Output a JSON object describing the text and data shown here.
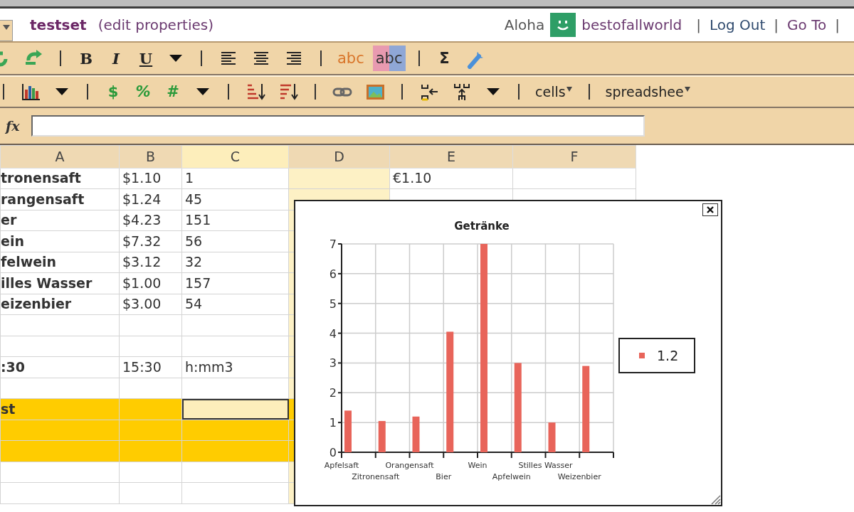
{
  "header": {
    "title": "testset",
    "edit_link": "(edit properties)",
    "greeting": "Aloha",
    "user": "bestofallworld",
    "links": [
      {
        "kind": "separator",
        "text": "|"
      },
      {
        "kind": "link",
        "text": "Log Out"
      },
      {
        "kind": "separator",
        "text": "|"
      },
      {
        "kind": "link",
        "text": "Go To"
      },
      {
        "kind": "separator",
        "text": "|"
      }
    ]
  },
  "toolbar_1": [
    {
      "kind": "undo"
    },
    {
      "kind": "redo"
    },
    {
      "kind": "sep"
    },
    {
      "kind": "bold",
      "text": "B"
    },
    {
      "kind": "italic",
      "text": "I"
    },
    {
      "kind": "underline",
      "text": "U"
    },
    {
      "kind": "caret"
    },
    {
      "kind": "sep"
    },
    {
      "kind": "align-left"
    },
    {
      "kind": "align-center"
    },
    {
      "kind": "align-right"
    },
    {
      "kind": "sep"
    },
    {
      "kind": "text-color",
      "text": "abc"
    },
    {
      "kind": "highlight",
      "text": "abc"
    },
    {
      "kind": "sep"
    },
    {
      "kind": "sum",
      "text": "Σ"
    },
    {
      "kind": "wrench"
    }
  ],
  "toolbar_2": [
    {
      "kind": "sep"
    },
    {
      "kind": "chart"
    },
    {
      "kind": "caret"
    },
    {
      "kind": "sep"
    },
    {
      "kind": "currency",
      "text": "$"
    },
    {
      "kind": "percent",
      "text": "%"
    },
    {
      "kind": "number",
      "text": "#"
    },
    {
      "kind": "caret"
    },
    {
      "kind": "sep"
    },
    {
      "kind": "sort-asc"
    },
    {
      "kind": "sort-desc"
    },
    {
      "kind": "sep"
    },
    {
      "kind": "link"
    },
    {
      "kind": "image"
    },
    {
      "kind": "sep"
    },
    {
      "kind": "merge"
    },
    {
      "kind": "split"
    },
    {
      "kind": "caret"
    },
    {
      "kind": "sep"
    },
    {
      "kind": "menu",
      "text": "cells"
    },
    {
      "kind": "sep"
    },
    {
      "kind": "menu",
      "text": "spreadshee"
    }
  ],
  "formula_bar": {
    "label": "fx"
  },
  "grid": {
    "columns": [
      {
        "label": "A",
        "selected": false,
        "tinted": false
      },
      {
        "label": "B",
        "selected": false,
        "tinted": false
      },
      {
        "label": "C",
        "selected": true,
        "tinted": false
      },
      {
        "label": "D",
        "selected": false,
        "tinted": true
      },
      {
        "label": "E",
        "selected": false,
        "tinted": false
      },
      {
        "label": "F",
        "selected": false,
        "tinted": false
      }
    ],
    "rows": [
      {
        "highlighted": false,
        "selected": false,
        "cells": {
          "A": "tronensaft",
          "B": "$1.10",
          "C": "1",
          "E": "€1.10"
        }
      },
      {
        "highlighted": false,
        "selected": false,
        "cells": {
          "A": "rangensaft",
          "B": "$1.24",
          "C": "45"
        }
      },
      {
        "highlighted": false,
        "selected": false,
        "cells": {
          "A": "er",
          "B": "$4.23",
          "C": "151"
        }
      },
      {
        "highlighted": false,
        "selected": false,
        "cells": {
          "A": "ein",
          "B": "$7.32",
          "C": "56"
        }
      },
      {
        "highlighted": false,
        "selected": false,
        "cells": {
          "A": "felwein",
          "B": "$3.12",
          "C": "32"
        }
      },
      {
        "highlighted": false,
        "selected": false,
        "cells": {
          "A": "illes Wasser",
          "B": "$1.00",
          "C": "157"
        }
      },
      {
        "highlighted": false,
        "selected": false,
        "cells": {
          "A": "eizenbier",
          "B": "$3.00",
          "C": "54"
        }
      },
      {
        "highlighted": false,
        "selected": false,
        "cells": {}
      },
      {
        "highlighted": false,
        "selected": false,
        "cells": {}
      },
      {
        "highlighted": false,
        "selected": false,
        "cells": {
          "A": ":30",
          "B": "15:30",
          "C": "h:mm3"
        }
      },
      {
        "highlighted": false,
        "selected": false,
        "cells": {}
      },
      {
        "highlighted": true,
        "selected": true,
        "cells": {
          "A": "st"
        }
      },
      {
        "highlighted": true,
        "selected": false,
        "cells": {}
      },
      {
        "highlighted": true,
        "selected": false,
        "cells": {}
      },
      {
        "highlighted": false,
        "selected": false,
        "cells": {}
      },
      {
        "highlighted": false,
        "selected": false,
        "cells": {}
      }
    ]
  },
  "chart_window": {
    "chart_data": {
      "type": "bar",
      "title": "Getränke",
      "categories": [
        "Apfelsaft",
        "Zitronensaft",
        "Orangensaft",
        "Bier",
        "Wein",
        "Apfelwein",
        "Stilles Wasser",
        "Weizenbier"
      ],
      "series": [
        {
          "name": "1.2",
          "color": "#e8645a",
          "values": [
            1.4,
            1.05,
            1.2,
            4.05,
            7,
            3,
            1,
            2.9
          ]
        }
      ],
      "ylim": [
        0,
        7
      ],
      "yticks": [
        {
          "value": 0,
          "label": "0"
        },
        {
          "value": 1,
          "label": "1"
        },
        {
          "value": 2,
          "label": "2"
        },
        {
          "value": 3,
          "label": "3"
        },
        {
          "value": 4,
          "label": "4"
        },
        {
          "value": 5,
          "label": "5"
        },
        {
          "value": 6,
          "label": "6"
        },
        {
          "value": 7,
          "label": "7"
        }
      ],
      "grid": true
    }
  }
}
